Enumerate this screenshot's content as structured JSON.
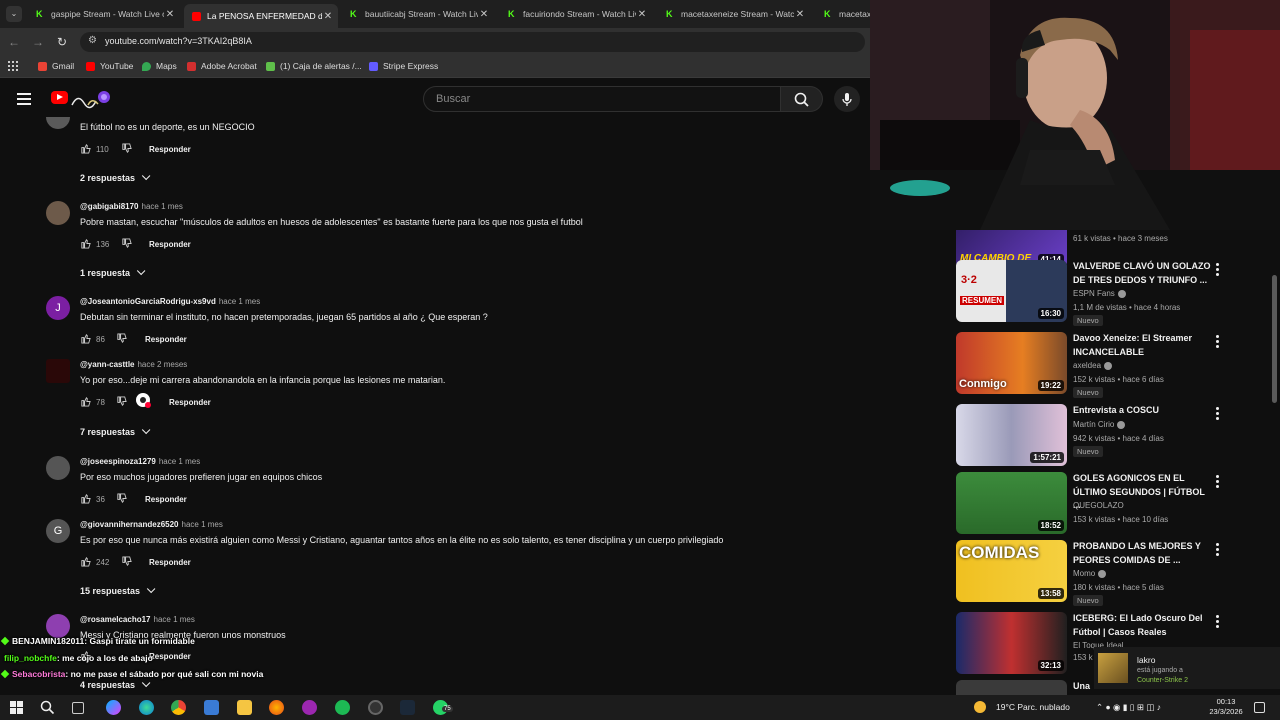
{
  "browser": {
    "tabs": [
      {
        "title": "gaspipe Stream - Watch Live on Kick",
        "icon": "kick-icon"
      },
      {
        "title": "La PENOSA ENFERMEDAD de los futbolistas",
        "icon": "youtube-icon",
        "active": true
      },
      {
        "title": "bauutiicabj Stream - Watch Live on Kick",
        "icon": "kick-icon"
      },
      {
        "title": "facuiriondo Stream - Watch Live on Kick",
        "icon": "kick-icon"
      },
      {
        "title": "macetaxeneize Stream - Watch Live on Kick",
        "icon": "kick-icon"
      },
      {
        "title": "macetax",
        "icon": "kick-icon"
      }
    ],
    "url": "youtube.com/watch?v=3TKAI2qB8IA",
    "bookmarks": [
      "Gmail",
      "YouTube",
      "Maps",
      "Adobe Acrobat",
      "(1) Caja de alertas /...",
      "Stripe Express"
    ]
  },
  "youtube": {
    "search_placeholder": "Buscar"
  },
  "comments": [
    {
      "text": "El fútbol no es un deporte, es un NEGOCIO",
      "likes": "110",
      "reply_label": "Responder",
      "replies": "2 respuestas"
    },
    {
      "handle": "@gabigabi8170",
      "ago": "hace 1 mes",
      "text": "Pobre mastan, escuchar \"músculos de adultos en huesos de adolescentes\" es bastante fuerte para los que nos gusta el futbol",
      "likes": "136",
      "reply_label": "Responder",
      "replies": "1 respuesta"
    },
    {
      "handle": "@JoseantonioGarciaRodrigu-xs9vd",
      "ago": "hace 1 mes",
      "avatar_letter": "J",
      "text": "Debutan sin terminar el instituto, no hacen pretemporadas, juegan 65 partidos al año ¿ Que esperan ?",
      "likes": "86",
      "reply_label": "Responder"
    },
    {
      "handle": "@yann-casttle",
      "ago": "hace 2 meses",
      "text": "Yo por eso...deje mi carrera abandonandola en la infancia porque las lesiones me matarian.",
      "likes": "78",
      "reply_label": "Responder",
      "replies": "7 respuestas"
    },
    {
      "handle": "@joseespinoza1279",
      "ago": "hace 1 mes",
      "text": "Por eso muchos jugadores prefieren jugar en equipos chicos",
      "likes": "36",
      "reply_label": "Responder"
    },
    {
      "handle": "@giovannihernandez6520",
      "ago": "hace 1 mes",
      "avatar_letter": "G",
      "text": "Es por eso que nunca más existirá alguien como Messi y Cristiano, aguantar tantos años en la élite no es solo talento, es tener disciplina y un cuerpo privilegiado",
      "likes": "242",
      "reply_label": "Responder",
      "replies": "15 respuestas"
    },
    {
      "handle": "@rosamelcacho17",
      "ago": "hace 1 mes",
      "text": "Messi y Cristiano realmente fueron unos monstruos",
      "reply_label": "Responder",
      "replies": "4 respuestas"
    }
  ],
  "sidebar": {
    "videos": [
      {
        "thumb_text": "MI CAMBIO DE",
        "duration": "41:14",
        "meta": "61 k vistas • hace 3 meses"
      },
      {
        "title": "VALVERDE CLAVÓ UN GOLAZO DE TRES DEDOS Y TRIUNFO ...",
        "channel": "ESPN Fans",
        "meta": "1,1 M de vistas • hace 4 horas",
        "badge": "Nuevo",
        "duration": "16:30",
        "thumb_text": "RESUMEN"
      },
      {
        "title": "Davoo Xeneize: El Streamer INCANCELABLE",
        "channel": "axeldea",
        "meta": "152 k vistas • hace 6 días",
        "badge": "Nuevo",
        "duration": "19:22",
        "thumb_text": "Conmigo"
      },
      {
        "title": "Entrevista a COSCU",
        "channel": "Martín Cirio",
        "meta": "942 k vistas • hace 4 días",
        "badge": "Nuevo",
        "duration": "1:57:21"
      },
      {
        "title": "GOLES AGONICOS EN EL ÚLTIMO SEGUNDOS | FÚTBOL ...",
        "channel": "QUEGOLAZO",
        "meta": "153 k vistas • hace 10 días",
        "duration": "18:52"
      },
      {
        "title": "PROBANDO LAS MEJORES Y PEORES COMIDAS DE ...",
        "channel": "Momo",
        "meta": "180 k vistas • hace 5 días",
        "badge": "Nuevo",
        "duration": "13:58",
        "thumb_text": "COMIDAS"
      },
      {
        "title": "ICEBERG: El Lado Oscuro Del Fútbol | Casos Reales",
        "channel": "El Toque Ideal",
        "meta": "153 k",
        "duration": "32:13"
      },
      {
        "title": "Una"
      }
    ]
  },
  "chat": [
    {
      "user": "BENJAMIN182011",
      "message": ": Gaspi tirate un formidable",
      "color": "#ffffff"
    },
    {
      "user": "filip_nobchfe",
      "message": ": me cojo a los de abajo",
      "color": "#53fc18"
    },
    {
      "user": "Sebacobrista",
      "message": ": no me pase el sábado por qué sali con mi novia",
      "color": "#ff7ad9"
    }
  ],
  "notification": {
    "name": "lakro",
    "line1": "está jugando a",
    "game": "Counter-Strike 2"
  },
  "taskbar": {
    "weather": "19°C  Parc. nublado",
    "time": "00:13",
    "date": "23/3/2026",
    "whatsapp_badge": "75"
  }
}
